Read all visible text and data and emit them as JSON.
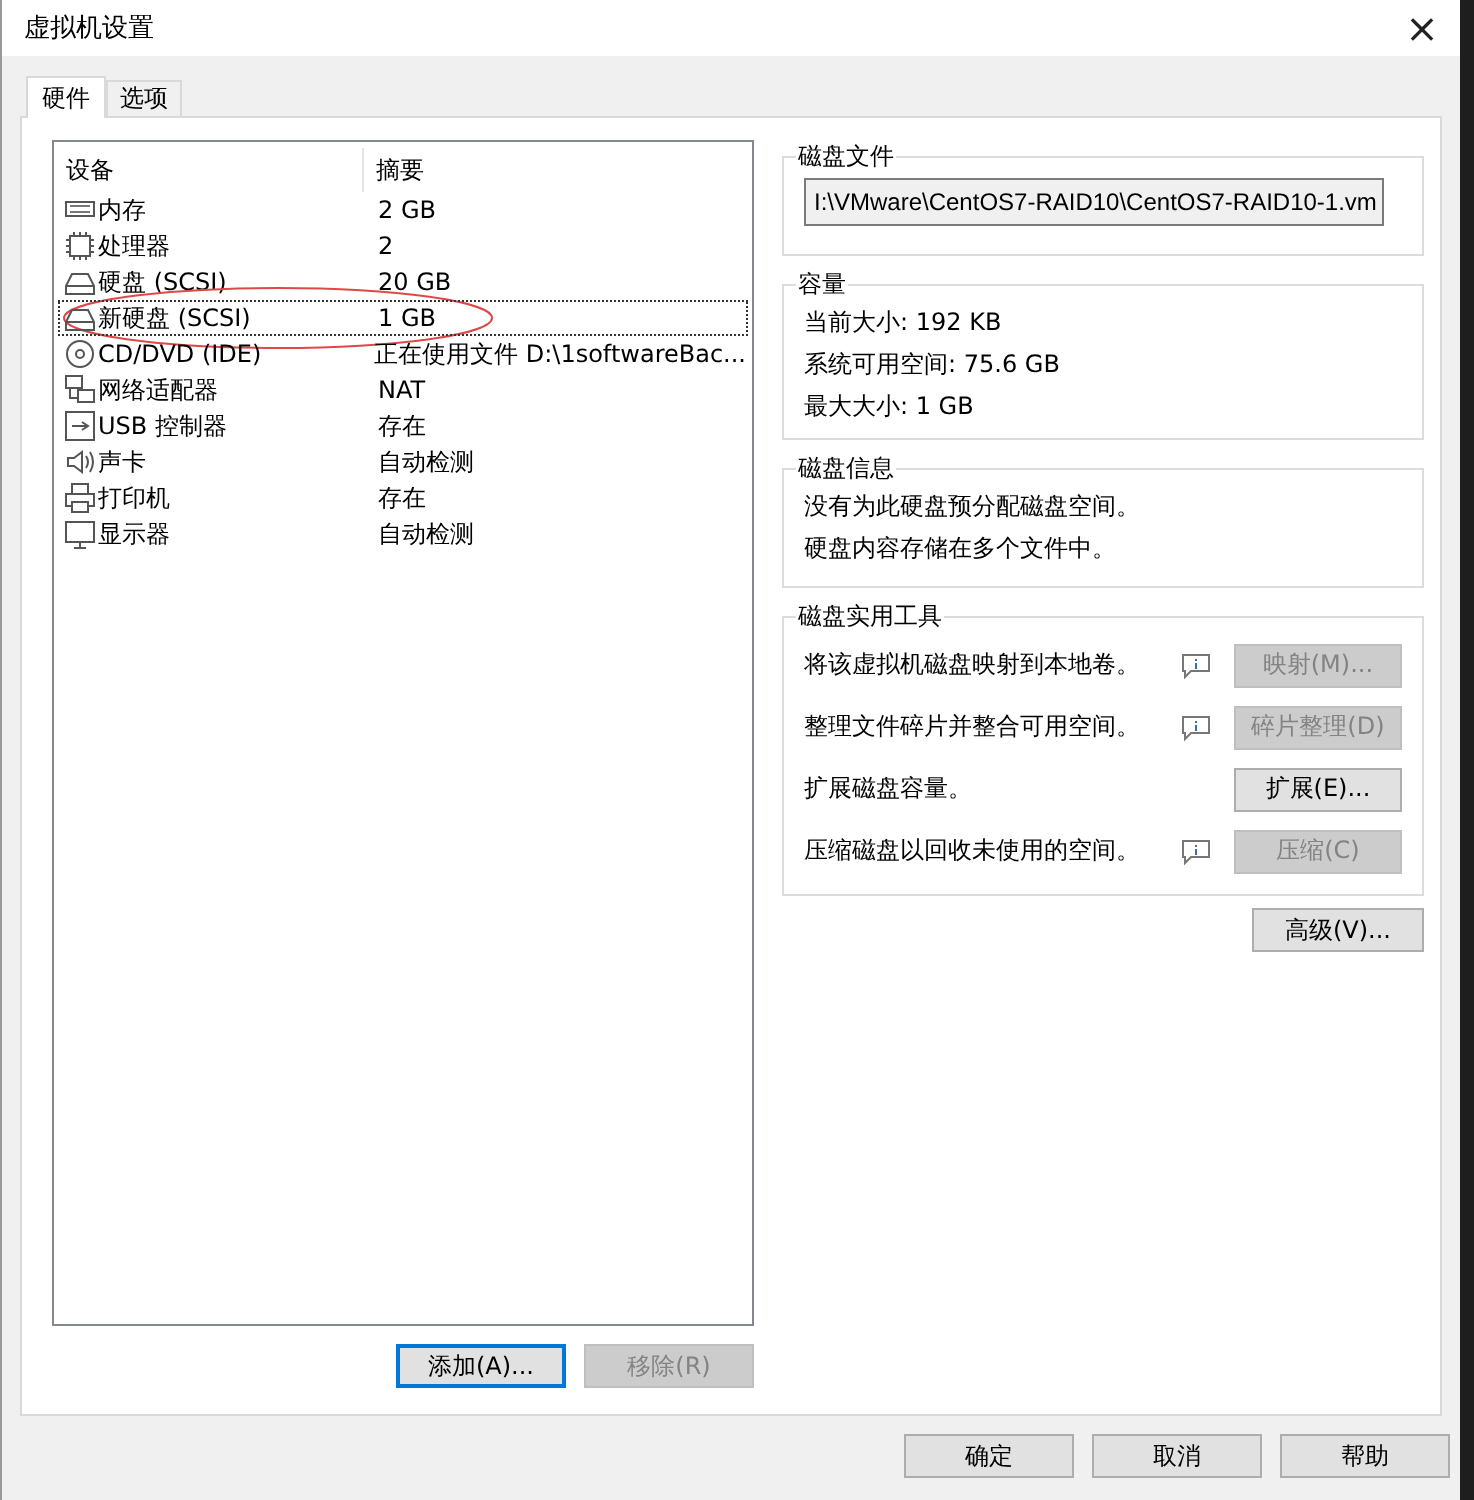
{
  "window": {
    "title": "虚拟机设置",
    "close": "×"
  },
  "tabs": [
    {
      "label": "硬件",
      "selected": true
    },
    {
      "label": "选项",
      "selected": false
    }
  ],
  "device_list": {
    "columns": [
      "设备",
      "摘要"
    ],
    "rows": [
      {
        "kind": "memory",
        "device": "内存",
        "summary": "2 GB",
        "selected": false,
        "circled": false
      },
      {
        "kind": "processor",
        "device": "处理器",
        "summary": "2",
        "selected": false,
        "circled": false
      },
      {
        "kind": "disk",
        "device": "硬盘 (SCSI)",
        "summary": "20 GB",
        "selected": false,
        "circled": false
      },
      {
        "kind": "disk",
        "device": "新硬盘 (SCSI)",
        "summary": "1 GB",
        "selected": true,
        "circled": true
      },
      {
        "kind": "cdrom",
        "device": "CD/DVD (IDE)",
        "summary": "正在使用文件 D:\\1softwareBac...",
        "selected": false,
        "circled": false
      },
      {
        "kind": "network",
        "device": "网络适配器",
        "summary": "NAT",
        "selected": false,
        "circled": false
      },
      {
        "kind": "usb",
        "device": "USB 控制器",
        "summary": "存在",
        "selected": false,
        "circled": false
      },
      {
        "kind": "sound",
        "device": "声卡",
        "summary": "自动检测",
        "selected": false,
        "circled": false
      },
      {
        "kind": "printer",
        "device": "打印机",
        "summary": "存在",
        "selected": false,
        "circled": false
      },
      {
        "kind": "display",
        "device": "显示器",
        "summary": "自动检测",
        "selected": false,
        "circled": false
      }
    ],
    "buttons": [
      {
        "label": "添加(A)...",
        "disabled": false,
        "default": true
      },
      {
        "label": "移除(R)",
        "disabled": true,
        "default": false
      }
    ]
  },
  "disk_file": {
    "title": "磁盘文件",
    "value": "I:\\VMware\\CentOS7-RAID10\\CentOS7-RAID10-1.vm"
  },
  "capacity": {
    "title": "容量",
    "lines": [
      "当前大小: 192 KB",
      "系统可用空间: 75.6 GB",
      "最大大小: 1 GB"
    ]
  },
  "disk_info": {
    "title": "磁盘信息",
    "lines": [
      "没有为此硬盘预分配磁盘空间。",
      "硬盘内容存储在多个文件中。"
    ]
  },
  "disk_utilities": {
    "title": "磁盘实用工具",
    "items": [
      {
        "text": "将该虚拟机磁盘映射到本地卷。",
        "info_icon": true,
        "button": "映射(M)...",
        "disabled": true
      },
      {
        "text": "整理文件碎片并整合可用空间。",
        "info_icon": true,
        "button": "碎片整理(D)",
        "disabled": true
      },
      {
        "text": "扩展磁盘容量。",
        "info_icon": false,
        "button": "扩展(E)...",
        "disabled": false
      },
      {
        "text": "压缩磁盘以回收未使用的空间。",
        "info_icon": true,
        "button": "压缩(C)",
        "disabled": true
      }
    ]
  },
  "advanced_button": "高级(V)...",
  "dialog_buttons": [
    "确定",
    "取消",
    "帮助"
  ]
}
